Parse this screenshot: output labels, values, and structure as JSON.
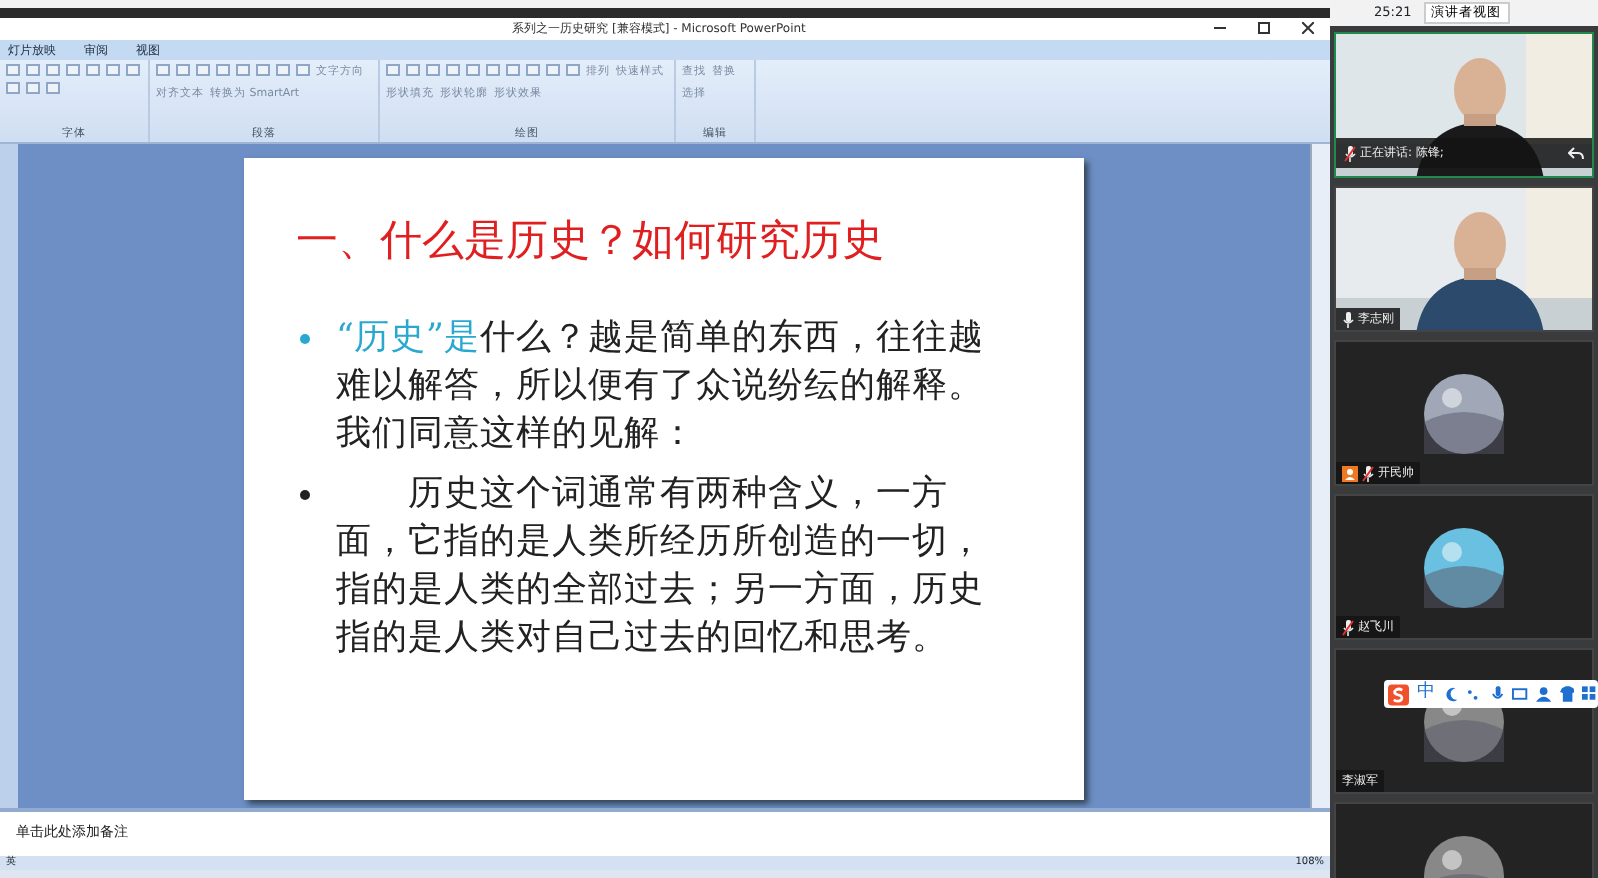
{
  "meeting_bar": {
    "time": "25:21",
    "view_button": "演讲者视图"
  },
  "window": {
    "title": "系列之一历史研究 [兼容模式] - Microsoft PowerPoint"
  },
  "tabs": [
    {
      "label": "灯片放映"
    },
    {
      "label": "审阅"
    },
    {
      "label": "视图"
    }
  ],
  "ribbon_groups": [
    {
      "label": "字体"
    },
    {
      "label": "段落",
      "items": [
        "文字方向",
        "对齐文本",
        "转换为 SmartArt"
      ]
    },
    {
      "label": "绘图",
      "items": [
        "排列",
        "快速样式",
        "形状填充",
        "形状轮廓",
        "形状效果"
      ]
    },
    {
      "label": "编辑",
      "items": [
        "查找",
        "替换",
        "选择"
      ]
    }
  ],
  "slide": {
    "title": "一、什么是历史？如何研究历史",
    "bullets": [
      {
        "color": "#29a9cf",
        "parts": [
          {
            "kind": "highlight",
            "text": "“历史”是"
          },
          {
            "kind": "plain",
            "text": "什么？越是简单的东西，往往越难以解答，所以便有了众说纷纭的解释。我们同意这样的见解："
          }
        ]
      },
      {
        "color": "#222222",
        "parts": [
          {
            "kind": "plain",
            "text": "　　历史这个词通常有两种含义，一方面，它指的是人类所经历所创造的一切，指的是人类的全部过去；另一方面，历史指的是人类对自己过去的回忆和思考。"
          }
        ]
      }
    ]
  },
  "notes": {
    "placeholder": "单击此处添加备注"
  },
  "status_bar": {
    "language": "英",
    "zoom": "108%"
  },
  "participants": [
    {
      "kind": "video",
      "name": "正在讲话: 陈锋;",
      "muted": true,
      "host": false
    },
    {
      "kind": "video",
      "name": "李志刚",
      "muted": false,
      "host": false
    },
    {
      "kind": "avatar",
      "name": "开民帅",
      "muted": true,
      "host": true
    },
    {
      "kind": "avatar",
      "name": "赵飞川",
      "muted": true,
      "host": false
    },
    {
      "kind": "avatar",
      "name": "李淑军",
      "host": false
    },
    {
      "kind": "avatar",
      "host": false
    }
  ],
  "ime_toolbar": {
    "mode": "中"
  }
}
